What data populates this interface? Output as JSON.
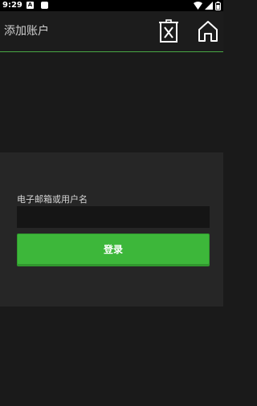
{
  "status_bar": {
    "time": "9:29",
    "notification_letter": "A",
    "icons": [
      "app-notification-icon",
      "square-notification-icon",
      "wifi-icon",
      "cellular-signal-icon",
      "battery-icon"
    ]
  },
  "app_bar": {
    "title": "添加账户",
    "actions": [
      "delete-icon",
      "home-icon"
    ]
  },
  "form": {
    "username_label": "电子邮箱或用户名",
    "username_value": "",
    "login_label": "登录"
  },
  "colors": {
    "background": "#1a1a1a",
    "panel": "#262626",
    "accent_green": "#3db73a",
    "divider_green": "#49a944",
    "input_background": "#151515"
  }
}
